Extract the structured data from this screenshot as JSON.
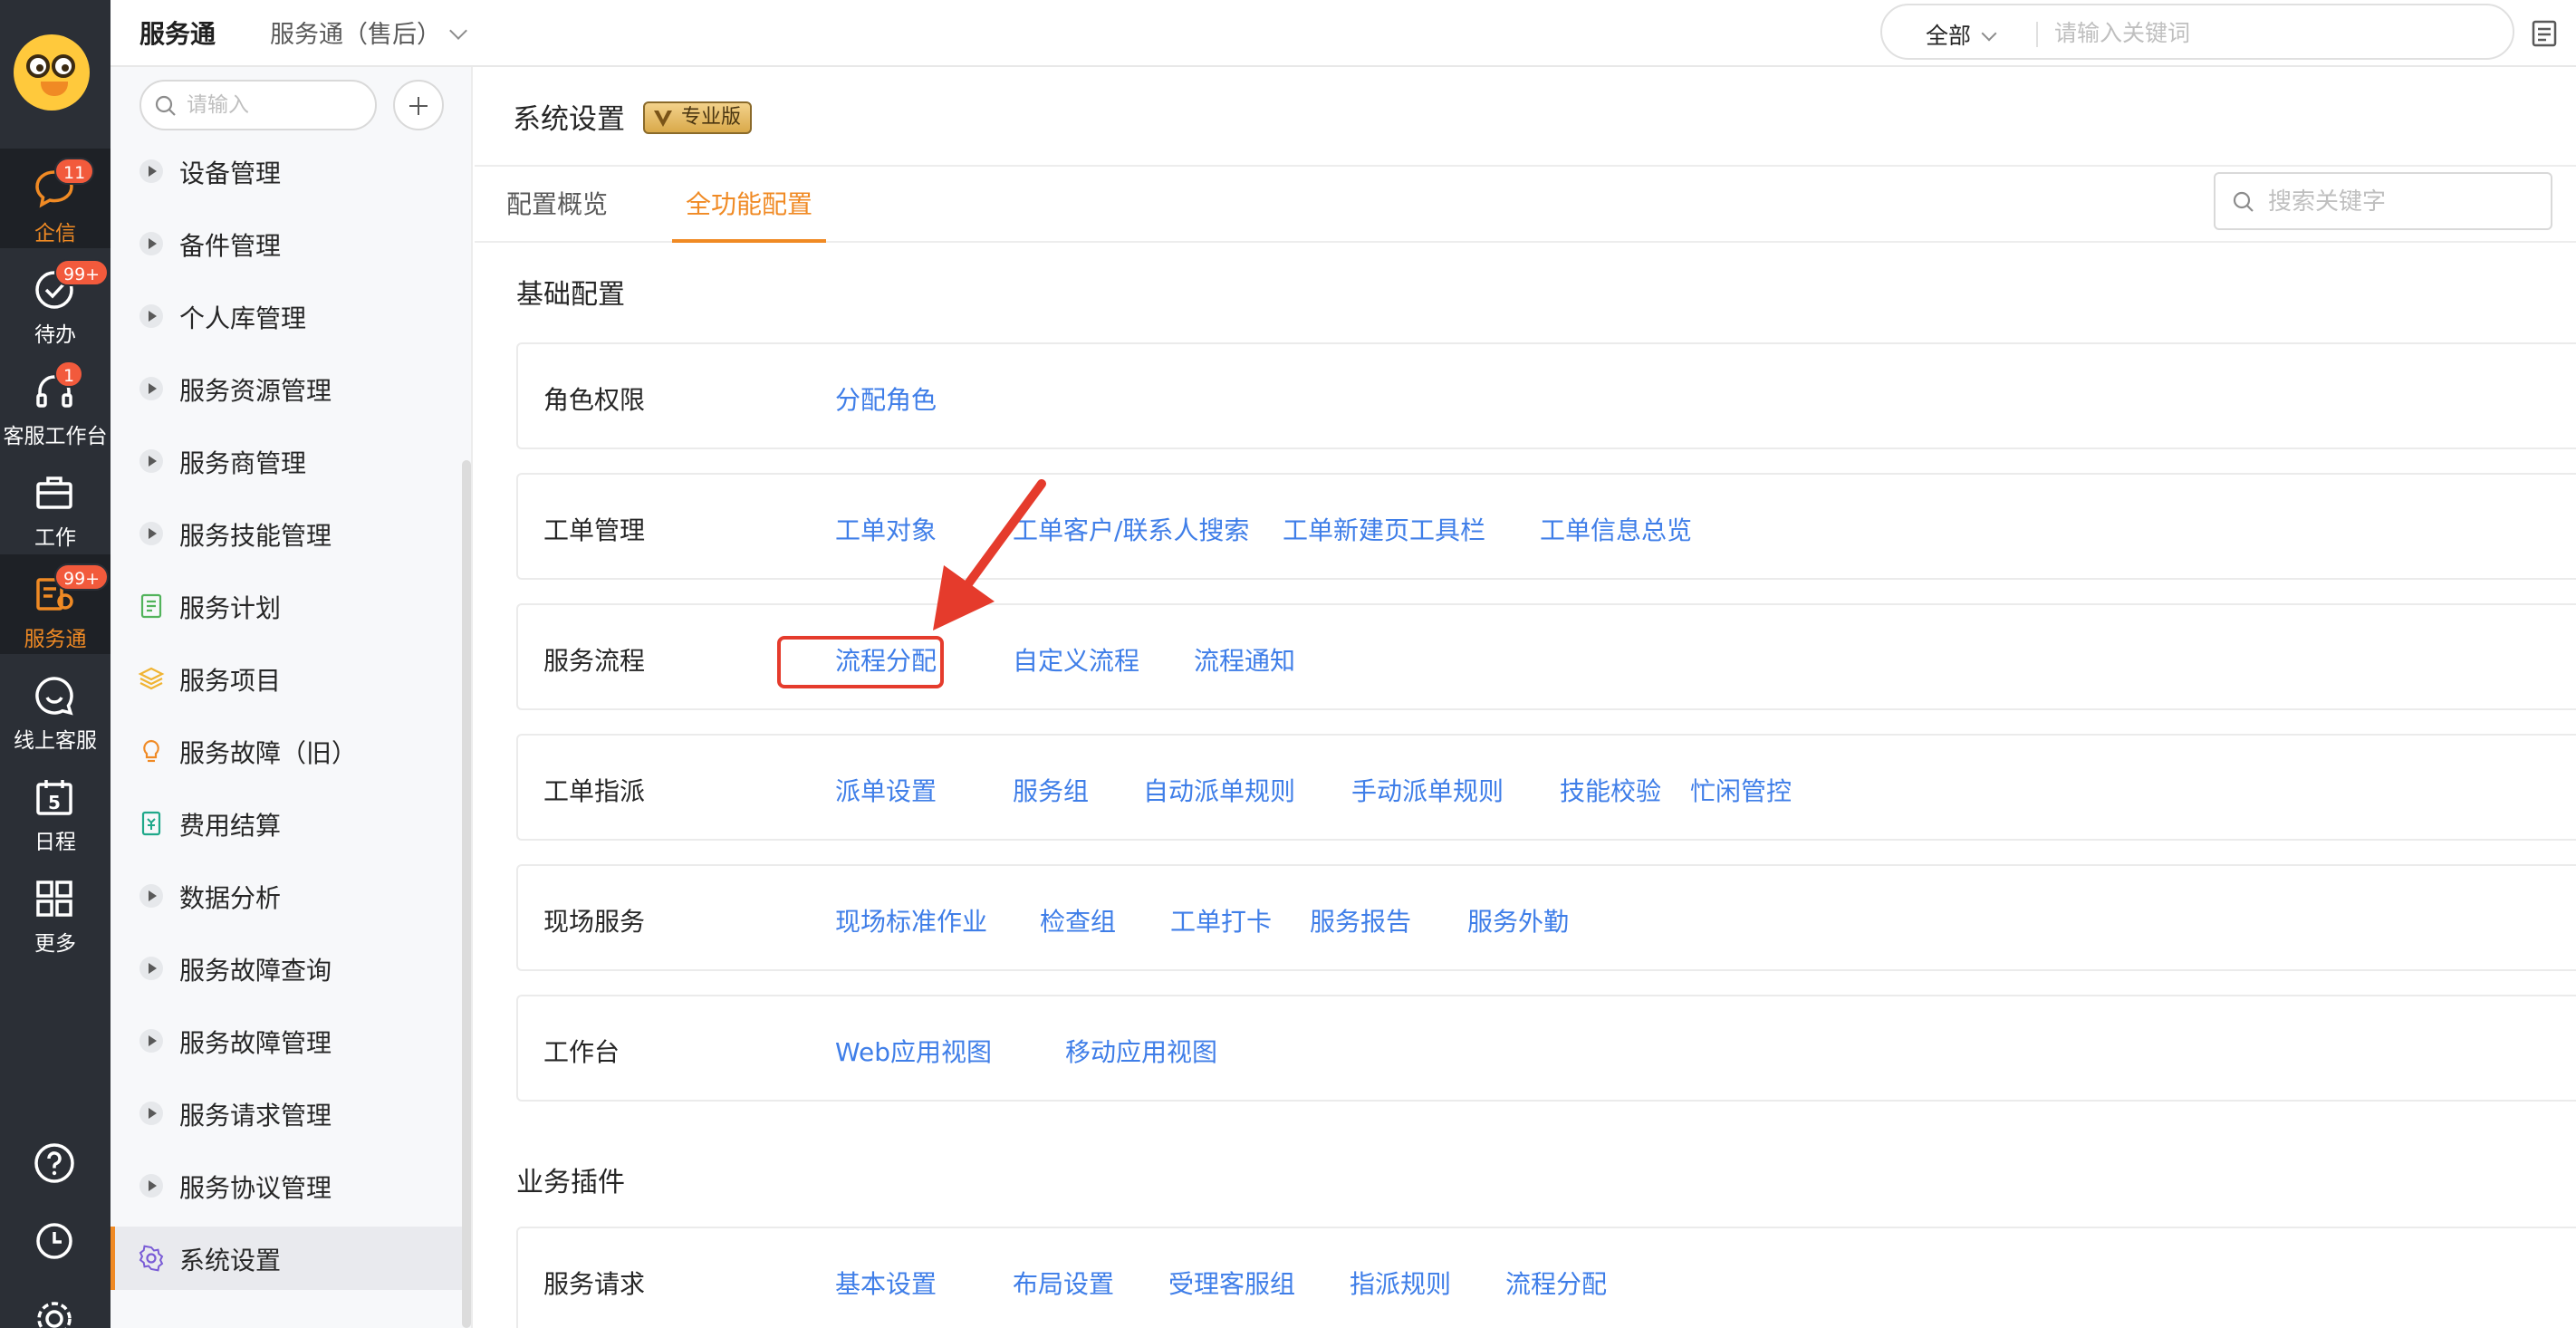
{
  "rail": {
    "items": [
      {
        "label": "企信",
        "icon": "chat-bubble-icon",
        "badge": "11",
        "active": true
      },
      {
        "label": "待办",
        "icon": "check-circle-icon",
        "badge": "99+"
      },
      {
        "label": "客服工作台",
        "icon": "headset-icon",
        "badge": "1"
      },
      {
        "label": "工作",
        "icon": "briefcase-icon",
        "badge": ""
      },
      {
        "label": "服务通",
        "icon": "service-tool-icon",
        "badge": "99+",
        "active": true
      },
      {
        "label": "线上客服",
        "icon": "smile-chat-icon",
        "badge": ""
      },
      {
        "label": "日程",
        "icon": "calendar-icon",
        "badge": "",
        "day": "5"
      },
      {
        "label": "更多",
        "icon": "grid-icon",
        "badge": ""
      }
    ],
    "bottom": [
      "help-icon",
      "clock-icon",
      "settings-icon"
    ]
  },
  "header": {
    "app_name": "服务通",
    "app_switch": "服务通（售后）",
    "search_scope": "全部",
    "search_placeholder": "请输入关键词"
  },
  "sidebar": {
    "search_placeholder": "请输入",
    "items": [
      {
        "label": "设备管理",
        "icon": "arrow"
      },
      {
        "label": "备件管理",
        "icon": "arrow"
      },
      {
        "label": "个人库管理",
        "icon": "arrow"
      },
      {
        "label": "服务资源管理",
        "icon": "arrow"
      },
      {
        "label": "服务商管理",
        "icon": "arrow"
      },
      {
        "label": "服务技能管理",
        "icon": "arrow"
      },
      {
        "label": "服务计划",
        "icon": "plan-icon"
      },
      {
        "label": "服务项目",
        "icon": "layers-icon"
      },
      {
        "label": "服务故障（旧）",
        "icon": "bulb-icon"
      },
      {
        "label": "费用结算",
        "icon": "bill-icon"
      },
      {
        "label": "数据分析",
        "icon": "arrow"
      },
      {
        "label": "服务故障查询",
        "icon": "arrow"
      },
      {
        "label": "服务故障管理",
        "icon": "arrow"
      },
      {
        "label": "服务请求管理",
        "icon": "arrow"
      },
      {
        "label": "服务协议管理",
        "icon": "arrow"
      },
      {
        "label": "系统设置",
        "icon": "gear-icon",
        "active": true
      }
    ]
  },
  "page": {
    "title": "系统设置",
    "badge": "专业版",
    "tabs": [
      {
        "label": "配置概览"
      },
      {
        "label": "全功能配置",
        "active": true
      }
    ],
    "search_placeholder": "搜索关键字",
    "sections": [
      {
        "title": "基础配置",
        "rows": [
          {
            "label": "角色权限",
            "links": [
              "分配角色"
            ]
          },
          {
            "label": "工单管理",
            "links": [
              "工单对象",
              "工单客户/联系人搜索",
              "工单新建页工具栏",
              "工单信息总览"
            ]
          },
          {
            "label": "服务流程",
            "links": [
              "流程分配",
              "自定义流程",
              "流程通知"
            ]
          },
          {
            "label": "工单指派",
            "links": [
              "派单设置",
              "服务组",
              "自动派单规则",
              "手动派单规则",
              "技能校验",
              "忙闲管控"
            ]
          },
          {
            "label": "现场服务",
            "links": [
              "现场标准作业",
              "检查组",
              "工单打卡",
              "服务报告",
              "服务外勤"
            ]
          },
          {
            "label": "工作台",
            "links": [
              "Web应用视图",
              "移动应用视图"
            ]
          }
        ]
      },
      {
        "title": "业务插件",
        "rows": [
          {
            "label": "服务请求",
            "links": [
              "基本设置",
              "布局设置",
              "受理客服组",
              "指派规则",
              "流程分配"
            ]
          }
        ]
      }
    ]
  },
  "colors": {
    "accent": "#f08a24",
    "link": "#3f7ee8",
    "rail_bg": "#2b2f36",
    "annotation": "#e53b2c"
  }
}
